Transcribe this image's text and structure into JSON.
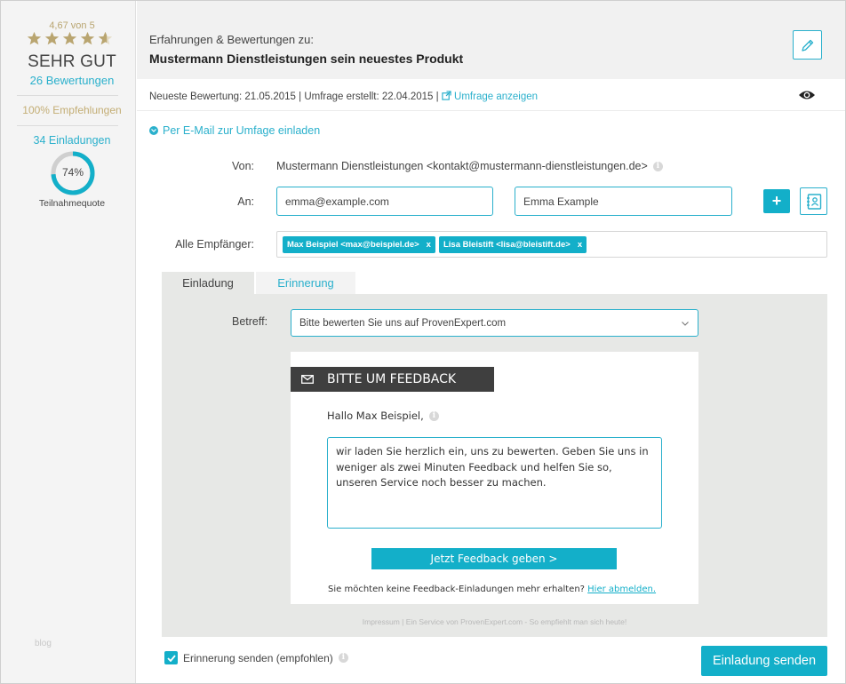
{
  "sidebar": {
    "rating_text": "4,67 von 5",
    "stars": {
      "value": 4.67,
      "max": 5,
      "color": "#c3ad74"
    },
    "rating_word": "SEHR GUT",
    "reviews": "26 Bewertungen",
    "recommendations": "100% Empfehlungen",
    "invitations": "34 Einladungen",
    "participation": {
      "percent": 74,
      "label": "74%",
      "caption": "Teilnahmequote"
    },
    "blog": "blog"
  },
  "header": {
    "subtitle": "Erfahrungen & Bewertungen zu:",
    "title": "Mustermann Dienstleistungen sein neuestes Produkt",
    "edit_icon": "pencil-icon"
  },
  "meta": {
    "latest_review": "Neueste Bewertung: 21.05.2015",
    "survey_created": "Umfrage erstellt: 22.04.2015",
    "show_survey": "Umfrage anzeigen"
  },
  "invite_toggle": "Per E-Mail zur Umfage einladen",
  "form": {
    "from_label": "Von:",
    "from_value": "Mustermann Dienstleistungen <kontakt@mustermann-dienstleistungen.de>",
    "to_label": "An:",
    "email_value": "emma@example.com",
    "name_value": "Emma Example",
    "plus": "+",
    "recipients_label": "Alle Empfänger:",
    "recipients": [
      {
        "label": "Max Beispiel <max@beispiel.de>",
        "remove": "x"
      },
      {
        "label": "Lisa Bleistift <lisa@bleistift.de>",
        "remove": "x"
      }
    ]
  },
  "tabs": [
    {
      "label": "Einladung",
      "active": true
    },
    {
      "label": "Erinnerung",
      "active": false
    }
  ],
  "subject": {
    "label": "Betreff:",
    "selected": "Bitte bewerten Sie uns auf ProvenExpert.com"
  },
  "email": {
    "heading": "BITTE UM FEEDBACK",
    "greeting": "Hallo Max Beispiel,",
    "body": "wir laden Sie herzlich ein, uns zu bewerten. Geben Sie uns in weniger als zwei Minuten Feedback und helfen Sie so, unseren Service noch besser zu machen.",
    "button": "Jetzt Feedback geben >",
    "unsubscribe_text": "Sie möchten keine Feedback-Einladungen mehr erhalten?",
    "unsubscribe_link": "Hier abmelden."
  },
  "footer_note": "Impressum | Ein Service von ProvenExpert.com - So empfiehlt man sich heute!",
  "reminder_checkbox": {
    "label": "Erinnerung senden (empfohlen)",
    "checked": true
  },
  "send_button": "Einladung senden",
  "colors": {
    "accent": "#13afc9",
    "gold": "#c3ad74",
    "panel": "#e7e8e6"
  }
}
